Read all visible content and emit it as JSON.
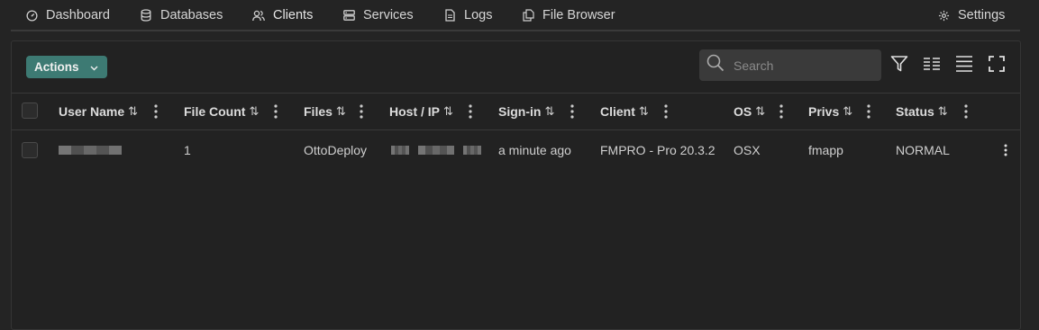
{
  "nav": {
    "tabs": [
      {
        "label": "Dashboard",
        "icon": "gauge-icon"
      },
      {
        "label": "Databases",
        "icon": "database-icon"
      },
      {
        "label": "Clients",
        "icon": "users-icon"
      },
      {
        "label": "Services",
        "icon": "server-icon"
      },
      {
        "label": "Logs",
        "icon": "document-icon"
      },
      {
        "label": "File Browser",
        "icon": "files-icon"
      }
    ],
    "active": "Clients",
    "settings_label": "Settings"
  },
  "toolbar": {
    "actions_label": "Actions",
    "search_placeholder": "Search"
  },
  "table": {
    "sort_glyph": "⇅",
    "columns": [
      "User Name",
      "File Count",
      "Files",
      "Host / IP",
      "Sign-in",
      "Client",
      "OS",
      "Privs",
      "Status"
    ],
    "rows": [
      {
        "user_name": "",
        "file_count": "1",
        "files": "OttoDeploy",
        "host_ip": "",
        "sign_in": "a minute ago",
        "client": "FMPRO - Pro 20.3.2",
        "os": "OSX",
        "privs": "fmapp",
        "status": "NORMAL"
      }
    ]
  },
  "colors": {
    "accent": "#3d7a73",
    "background": "#242424"
  }
}
